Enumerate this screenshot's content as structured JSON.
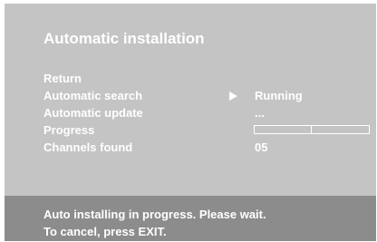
{
  "window": {
    "title": "Automatic installation"
  },
  "menu": {
    "items": [
      {
        "label": "Return"
      },
      {
        "label": "Automatic search"
      },
      {
        "label": "Automatic update"
      },
      {
        "label": "Progress"
      },
      {
        "label": "Channels found"
      }
    ]
  },
  "values": {
    "automatic_search": "Running",
    "automatic_update": "...",
    "progress_fraction": 0.5,
    "channels_found": "05"
  },
  "icons": {
    "selection_indicator": "play-arrow-icon"
  },
  "footer": {
    "line1": "Auto installing in progress. Please wait.",
    "line2": "To cancel, press EXIT."
  },
  "colors": {
    "panel": "#c4c4c4",
    "footer": "#8c8c8c",
    "text": "#ffffff"
  }
}
